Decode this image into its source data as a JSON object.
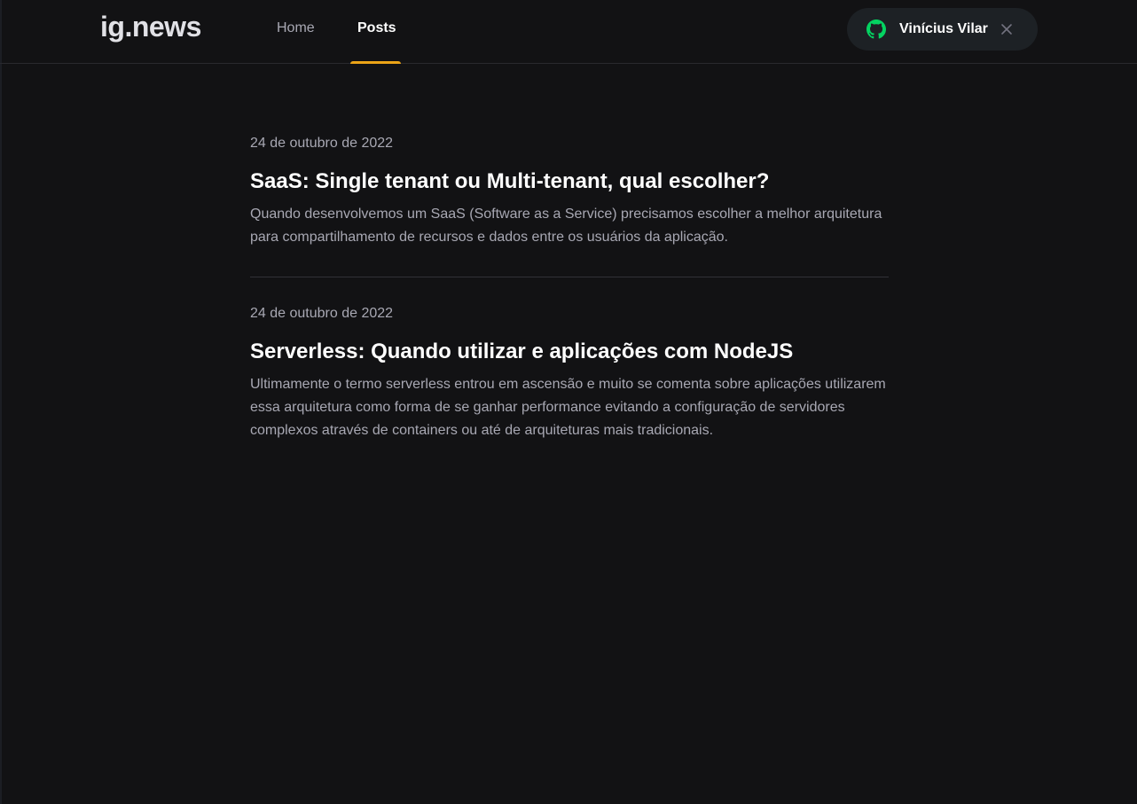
{
  "header": {
    "logo": "ig.news",
    "nav": {
      "home_label": "Home",
      "posts_label": "Posts",
      "active": "Posts"
    },
    "signin": {
      "user_name": "Vinícius Vilar",
      "provider_icon": "github-icon",
      "close_icon": "close-icon"
    }
  },
  "posts": [
    {
      "date": "24 de outubro de 2022",
      "title": "SaaS: Single tenant ou Multi-tenant, qual escolher?",
      "excerpt": "Quando desenvolvemos um SaaS (Software as a Service) precisamos escolher a melhor arquitetura para compartilhamento de recursos e dados entre os usuários da aplicação."
    },
    {
      "date": "24 de outubro de 2022",
      "title": "Serverless: Quando utilizar e aplicações com NodeJS",
      "excerpt": "Ultimamente o termo serverless entrou em ascensão e muito se comenta sobre aplicações utilizarem essa arquitetura como forma de se ganhar performance evitando a configuração de servidores complexos através de containers ou até de arquiteturas mais tradicionais."
    }
  ],
  "colors": {
    "background": "#121214",
    "accent": "#eba417",
    "github_green": "#04d361",
    "text_primary": "#ffffff",
    "text_secondary": "#a8a8b3"
  }
}
